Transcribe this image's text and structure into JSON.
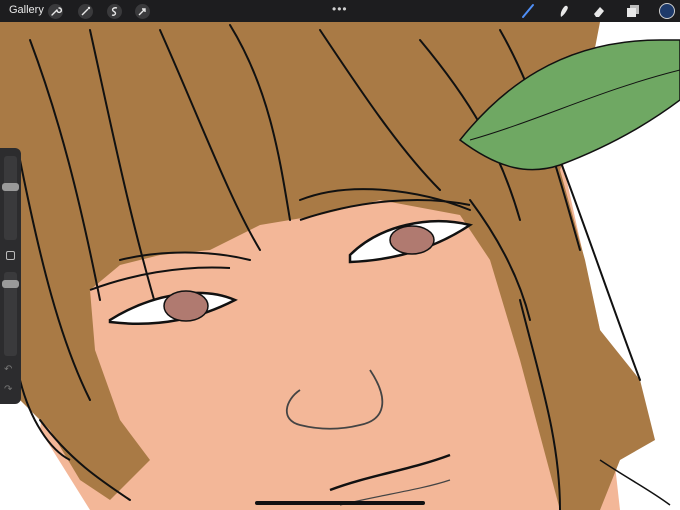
{
  "topbar": {
    "gallery_label": "Gallery",
    "tools": [
      {
        "name": "actions-wrench-icon"
      },
      {
        "name": "adjustments-wand-icon"
      },
      {
        "name": "selection-icon"
      },
      {
        "name": "transform-arrow-icon"
      }
    ],
    "more_dots": "•••",
    "right_tools": [
      "brush-icon",
      "smudge-icon",
      "eraser-icon",
      "layers-icon"
    ],
    "active_color": "#1e3a6a"
  },
  "sidebar": {
    "brush_size_level": 0.35,
    "opacity_level": 0.1,
    "undo_glyph": "↶",
    "redo_glyph": "↷"
  },
  "canvas_colors": {
    "hair": "#a97a45",
    "skin": "#f3b798",
    "leaf": "#6fa863",
    "iris": "#b07a70",
    "line": "#111111"
  }
}
